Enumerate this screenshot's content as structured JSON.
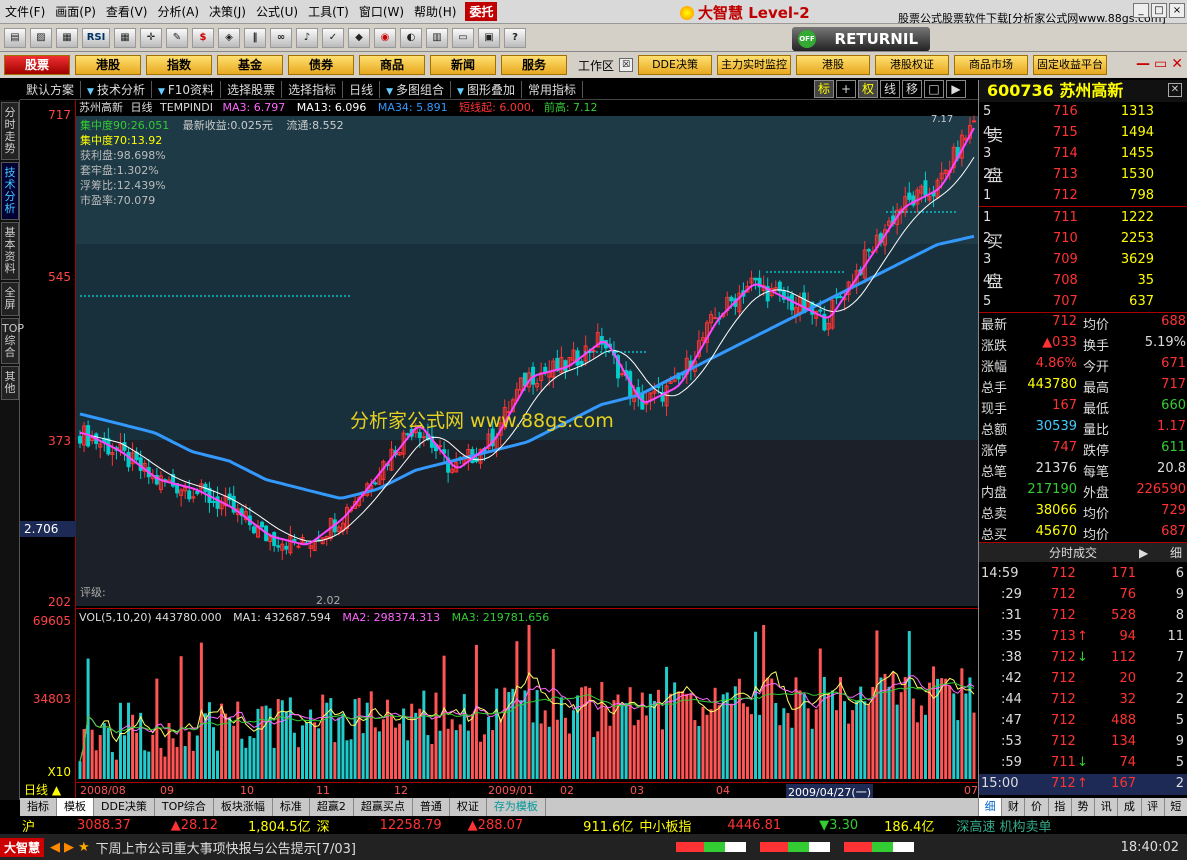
{
  "menu": {
    "items": [
      "文件(F)",
      "画面(P)",
      "查看(V)",
      "分析(A)",
      "决策(J)",
      "公式(U)",
      "工具(T)",
      "窗口(W)",
      "帮助(H)"
    ],
    "entrust": "委托",
    "brand": "大智慧 Level-2",
    "adlink": "股票公式股票软件下载[分析家公式网www.88gs.com]"
  },
  "toolbar": {
    "icons": [
      "folder-icon",
      "chart-icon",
      "grid-icon",
      "rsi-icon",
      "table-icon",
      "crosshair-icon",
      "ruler-icon",
      "dollar-icon",
      "indicator-icon",
      "bars-icon",
      "binoculars-icon",
      "bell-icon",
      "check-icon",
      "diamond-icon",
      "block-icon",
      "pie-icon",
      "book-icon",
      "window-icon",
      "database-icon",
      "help-icon"
    ],
    "rsi_label": "RSI",
    "returnil_label": "RETURNIL",
    "returnil_badge": "OFF"
  },
  "nav": {
    "buttons": [
      "股票",
      "港股",
      "指数",
      "基金",
      "债券",
      "商品",
      "新闻",
      "服务"
    ],
    "workspace_label": "工作区",
    "extra_buttons": [
      "DDE决策",
      "主力实时监控",
      "港股",
      "港股权证",
      "商品市场",
      "固定收益平台"
    ]
  },
  "subbar": {
    "items": [
      "默认方案",
      "技术分析",
      "F10资料",
      "选择股票",
      "选择指标",
      "日线",
      "多图组合",
      "图形叠加",
      "常用指标"
    ]
  },
  "chart_tools": [
    "标",
    "+",
    "权",
    "线",
    "移",
    "□",
    "▶"
  ],
  "left_tabs": [
    "分时走势",
    "技术分析",
    "基本资料",
    "全屏",
    "TOP综合",
    "其他"
  ],
  "chart_header": {
    "stock": "苏州高新",
    "period": "日线",
    "formula": "TEMPINDI",
    "ma3": "MA3: 6.797",
    "ma13": "MA13: 6.096",
    "ma34": "MA34: 5.891",
    "short_line": "短线起: 6.000,",
    "high_prev": "前高: 7.12"
  },
  "stats": {
    "conc90": "集中度90:26.051",
    "conc70": "集中度70:13.92",
    "profit": "获利盘:98.698%",
    "trapped": "套牢盘:1.302%",
    "float_ratio": "浮筹比:12.439%",
    "pe": "市盈率:70.079",
    "latest_gain": "最新收益:0.025元",
    "circulation": "流通:8.552"
  },
  "watermark": "分析家公式网 www.88gs.com",
  "rating_label": "评级:",
  "price_axis": {
    "ticks": [
      "717",
      "545",
      "373",
      "202"
    ],
    "current": "2.706"
  },
  "vol_axis": {
    "ticks": [
      "69605",
      "34803"
    ],
    "multiplier": "X10"
  },
  "vol_header": {
    "vol": "VOL(5,10,20) 443780.000",
    "ma1": "MA1: 432687.594",
    "ma2": "MA2: 298374.313",
    "ma3": "MA3: 219781.656"
  },
  "annotations": {
    "low": "2.02",
    "high": "7.17"
  },
  "x_axis": {
    "labels": [
      "2008/08",
      "09",
      "10",
      "11",
      "12",
      "2009/01",
      "02",
      "03",
      "04",
      "2009/04/27(一)",
      "07"
    ],
    "dayline": "日线"
  },
  "tabs": [
    "指标",
    "模板",
    "DDE决策",
    "TOP综合",
    "板块涨幅",
    "标准",
    "超赢2",
    "超赢买点",
    "普通",
    "权证",
    "存为模板"
  ],
  "index_bar": {
    "sh_label": "沪",
    "sh_value": "3088.37",
    "sh_change": "▲28.12",
    "sh_amount": "1,804.5亿",
    "sz_label": "深",
    "sz_value": "12258.79",
    "sz_change": "▲288.07",
    "sz_amount": "911.6亿",
    "sme_label": "中小板指",
    "sme_value": "4446.81",
    "sme_change": "▼3.30",
    "sme_amount": "186.4亿",
    "ticker": "深高速 机构卖单"
  },
  "news_bar": {
    "brand": "大智慧",
    "text": "下周上市公司重大事项快报与公告提示[7/03]",
    "time": "18:40:02"
  },
  "quote": {
    "code": "600736",
    "name": "苏州高新",
    "sell_label": [
      "卖",
      "盘"
    ],
    "buy_label": [
      "买",
      "盘"
    ],
    "asks": [
      {
        "lvl": "5",
        "price": "716",
        "vol": "1313"
      },
      {
        "lvl": "4",
        "price": "715",
        "vol": "1494"
      },
      {
        "lvl": "3",
        "price": "714",
        "vol": "1455"
      },
      {
        "lvl": "2",
        "price": "713",
        "vol": "1530"
      },
      {
        "lvl": "1",
        "price": "712",
        "vol": "798"
      }
    ],
    "bids": [
      {
        "lvl": "1",
        "price": "711",
        "vol": "1222"
      },
      {
        "lvl": "2",
        "price": "710",
        "vol": "2253"
      },
      {
        "lvl": "3",
        "price": "709",
        "vol": "3629"
      },
      {
        "lvl": "4",
        "price": "708",
        "vol": "35"
      },
      {
        "lvl": "5",
        "price": "707",
        "vol": "637"
      }
    ],
    "fields": [
      {
        "l1": "最新",
        "v1": "712",
        "c1": "red",
        "l2": "均价",
        "v2": "688",
        "c2": "red"
      },
      {
        "l1": "涨跌",
        "v1": "▲033",
        "c1": "red",
        "l2": "换手",
        "v2": "5.19%",
        "c2": "white"
      },
      {
        "l1": "涨幅",
        "v1": "4.86%",
        "c1": "red",
        "l2": "今开",
        "v2": "671",
        "c2": "red"
      },
      {
        "l1": "总手",
        "v1": "443780",
        "c1": "yellow",
        "l2": "最高",
        "v2": "717",
        "c2": "red"
      },
      {
        "l1": "现手",
        "v1": "167",
        "c1": "red",
        "l2": "最低",
        "v2": "660",
        "c2": "green"
      },
      {
        "l1": "总额",
        "v1": "30539",
        "c1": "cyan",
        "l2": "量比",
        "v2": "1.17",
        "c2": "red"
      },
      {
        "l1": "涨停",
        "v1": "747",
        "c1": "red",
        "l2": "跌停",
        "v2": "611",
        "c2": "green"
      },
      {
        "l1": "总笔",
        "v1": "21376",
        "c1": "white",
        "l2": "每笔",
        "v2": "20.8",
        "c2": "white"
      },
      {
        "l1": "内盘",
        "v1": "217190",
        "c1": "green",
        "l2": "外盘",
        "v2": "226590",
        "c2": "red"
      },
      {
        "l1": "总卖",
        "v1": "38066",
        "c1": "yellow",
        "l2": "均价",
        "v2": "729",
        "c2": "red"
      },
      {
        "l1": "总买",
        "v1": "45670",
        "c1": "yellow",
        "l2": "均价",
        "v2": "687",
        "c2": "red"
      }
    ],
    "ticks_title": "分时成交",
    "ticks_side_label": "细",
    "ticks": [
      {
        "t": "14:59",
        "p": "712",
        "a": "",
        "v": "171",
        "n": "6"
      },
      {
        "t": ":29",
        "p": "712",
        "a": "",
        "v": "76",
        "n": "9"
      },
      {
        "t": ":31",
        "p": "712",
        "a": "",
        "v": "528",
        "n": "8"
      },
      {
        "t": ":35",
        "p": "713",
        "a": "↑",
        "v": "94",
        "n": "11"
      },
      {
        "t": ":38",
        "p": "712",
        "a": "↓",
        "v": "112",
        "n": "7"
      },
      {
        "t": ":42",
        "p": "712",
        "a": "",
        "v": "20",
        "n": "2"
      },
      {
        "t": ":44",
        "p": "712",
        "a": "",
        "v": "32",
        "n": "2"
      },
      {
        "t": ":47",
        "p": "712",
        "a": "",
        "v": "488",
        "n": "5"
      },
      {
        "t": ":53",
        "p": "712",
        "a": "",
        "v": "134",
        "n": "9"
      },
      {
        "t": ":59",
        "p": "711",
        "a": "↓",
        "v": "74",
        "n": "5"
      },
      {
        "t": "15:00",
        "p": "712",
        "a": "↑",
        "v": "167",
        "n": "2"
      }
    ],
    "bottom_tabs": [
      "细",
      "财",
      "价",
      "指",
      "势",
      "讯",
      "成",
      "评",
      "短"
    ]
  },
  "colors": {
    "up": "#ff3333",
    "down": "#33cc33",
    "ma34": "#3399ff",
    "bg": "#000000",
    "accent": "#ffff00"
  },
  "chart_data": {
    "type": "line",
    "ylim": [
      2.02,
      7.17
    ],
    "yticks": [
      7.17,
      5.45,
      3.73,
      2.02
    ],
    "vol_ticks": [
      69605,
      34803
    ],
    "x": [
      "2008/08",
      "09",
      "10",
      "11",
      "12",
      "2009/01",
      "02",
      "03",
      "04",
      "2009/04/27",
      "07"
    ],
    "close_est": [
      3.8,
      3.6,
      3.3,
      3.2,
      3.0,
      2.7,
      2.6,
      2.9,
      3.4,
      3.9,
      3.4,
      3.7,
      4.4,
      4.5,
      4.8,
      4.1,
      4.3,
      5.0,
      5.4,
      5.2,
      5.0,
      5.6,
      6.2,
      6.4,
      7.12
    ],
    "ma34_est": [
      4.0,
      3.9,
      3.8,
      3.6,
      3.5,
      3.3,
      3.2,
      3.1,
      3.2,
      3.4,
      3.5,
      3.6,
      3.7,
      3.9,
      4.1,
      4.2,
      4.4,
      4.6,
      4.8,
      5.0,
      5.2,
      5.4,
      5.6,
      5.8,
      5.89
    ]
  }
}
